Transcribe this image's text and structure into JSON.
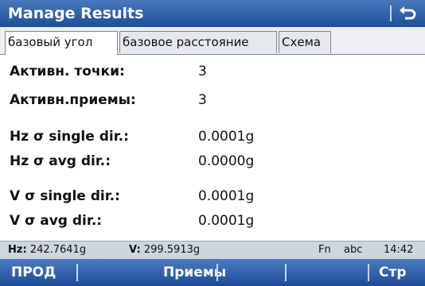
{
  "window": {
    "title": "Manage Results",
    "back_icon": "back-arrow-icon"
  },
  "tabs": [
    {
      "label": "базовый угол",
      "active": true
    },
    {
      "label": "базовое расстояние",
      "active": false
    },
    {
      "label": "Схема",
      "active": false
    }
  ],
  "rows": [
    {
      "label": "Активн. точки:",
      "value": "3"
    },
    {
      "label": "Активн.приемы:",
      "value": "3"
    },
    {
      "label": "Hz σ single dir.:",
      "value": "0.0001g"
    },
    {
      "label": "Hz σ avg dir.:",
      "value": "0.0000g"
    },
    {
      "label": "V σ single dir.:",
      "value": "0.0001g"
    },
    {
      "label": "V σ avg dir.:",
      "value": "0.0001g"
    }
  ],
  "status": {
    "hz_label": "Hz:",
    "hz_value": "242.7641g",
    "v_label": "V:",
    "v_value": "299.5913g",
    "fn": "Fn",
    "mode": "abc",
    "time": "14:42"
  },
  "softkeys": [
    "ПРОД",
    "Приемы",
    "",
    "",
    "Стр"
  ]
}
